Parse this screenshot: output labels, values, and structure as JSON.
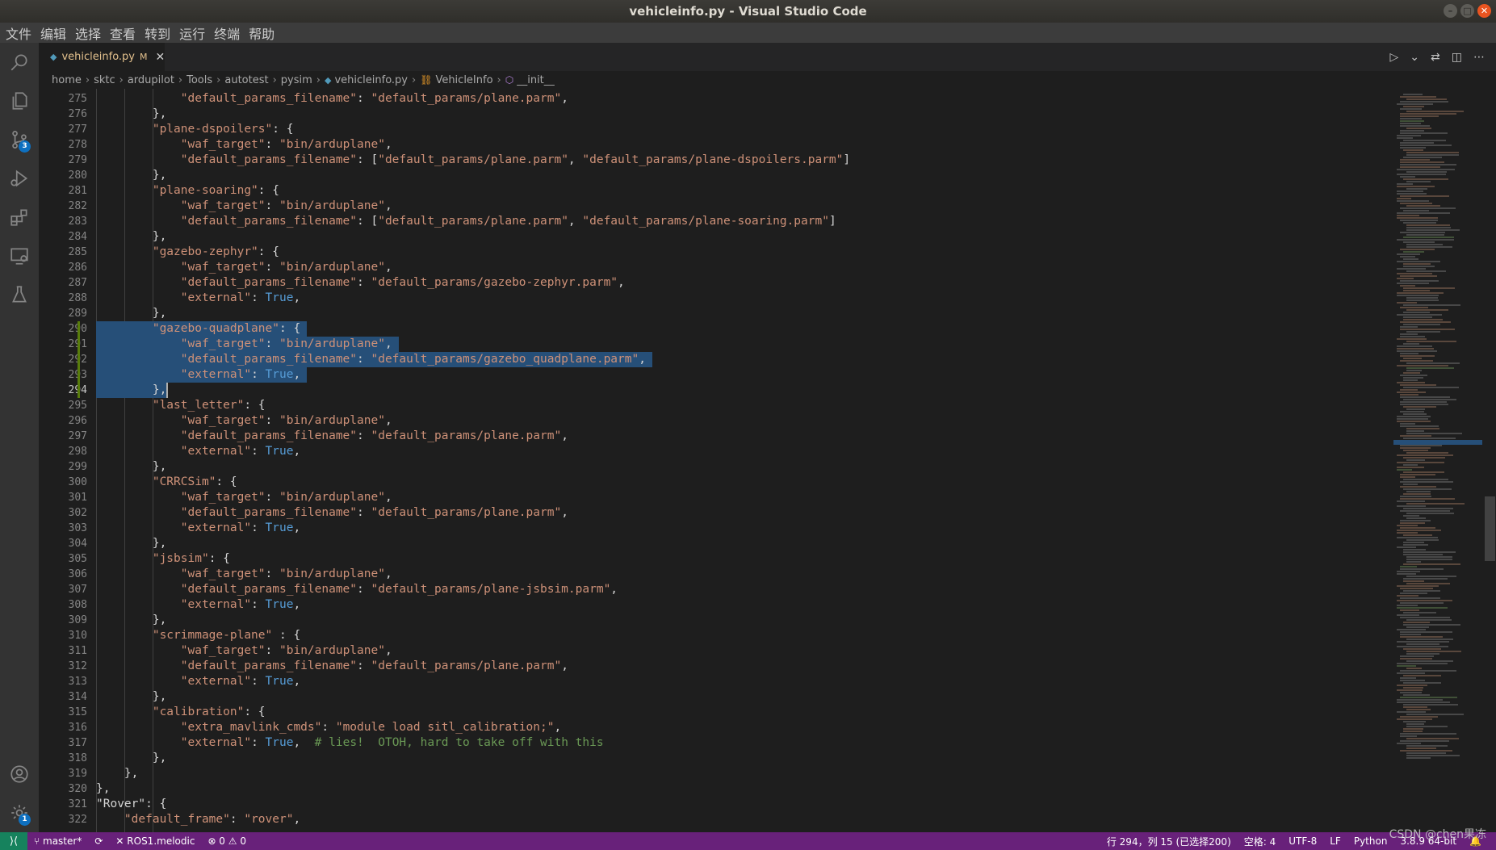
{
  "window": {
    "title": "vehicleinfo.py - Visual Studio Code"
  },
  "menu": [
    "文件",
    "编辑",
    "选择",
    "查看",
    "转到",
    "运行",
    "终端",
    "帮助"
  ],
  "activity": {
    "scm_badge": "3",
    "settings_badge": "1"
  },
  "tab": {
    "label": "vehicleinfo.py",
    "modified": "M"
  },
  "breadcrumbs": [
    "home",
    "sktc",
    "ardupilot",
    "Tools",
    "autotest",
    "pysim",
    "vehicleinfo.py",
    "VehicleInfo",
    "__init__"
  ],
  "editor": {
    "first_line": 275,
    "active_line": 294,
    "lines": [
      [
        [
          "",
          "            "
        ],
        [
          "s",
          "\"default_params_filename\""
        ],
        [
          "",
          ": "
        ],
        [
          "s",
          "\"default_params/plane.parm\""
        ],
        [
          "",
          ","
        ]
      ],
      [
        [
          "",
          "        },"
        ]
      ],
      [
        [
          "",
          "        "
        ],
        [
          "s",
          "\"plane-dspoilers\""
        ],
        [
          "",
          ": {"
        ]
      ],
      [
        [
          "",
          "            "
        ],
        [
          "s",
          "\"waf_target\""
        ],
        [
          "",
          ": "
        ],
        [
          "s",
          "\"bin/arduplane\""
        ],
        [
          "",
          ","
        ]
      ],
      [
        [
          "",
          "            "
        ],
        [
          "s",
          "\"default_params_filename\""
        ],
        [
          "",
          ": ["
        ],
        [
          "s",
          "\"default_params/plane.parm\""
        ],
        [
          "",
          ", "
        ],
        [
          "s",
          "\"default_params/plane-dspoilers.parm\""
        ],
        [
          "",
          "]"
        ]
      ],
      [
        [
          "",
          "        },"
        ]
      ],
      [
        [
          "",
          "        "
        ],
        [
          "s",
          "\"plane-soaring\""
        ],
        [
          "",
          ": {"
        ]
      ],
      [
        [
          "",
          "            "
        ],
        [
          "s",
          "\"waf_target\""
        ],
        [
          "",
          ": "
        ],
        [
          "s",
          "\"bin/arduplane\""
        ],
        [
          "",
          ","
        ]
      ],
      [
        [
          "",
          "            "
        ],
        [
          "s",
          "\"default_params_filename\""
        ],
        [
          "",
          ": ["
        ],
        [
          "s",
          "\"default_params/plane.parm\""
        ],
        [
          "",
          ", "
        ],
        [
          "s",
          "\"default_params/plane-soaring.parm\""
        ],
        [
          "",
          "]"
        ]
      ],
      [
        [
          "",
          "        },"
        ]
      ],
      [
        [
          "",
          "        "
        ],
        [
          "s",
          "\"gazebo-zephyr\""
        ],
        [
          "",
          ": {"
        ]
      ],
      [
        [
          "",
          "            "
        ],
        [
          "s",
          "\"waf_target\""
        ],
        [
          "",
          ": "
        ],
        [
          "s",
          "\"bin/arduplane\""
        ],
        [
          "",
          ","
        ]
      ],
      [
        [
          "",
          "            "
        ],
        [
          "s",
          "\"default_params_filename\""
        ],
        [
          "",
          ": "
        ],
        [
          "s",
          "\"default_params/gazebo-zephyr.parm\""
        ],
        [
          "",
          ","
        ]
      ],
      [
        [
          "",
          "            "
        ],
        [
          "s",
          "\"external\""
        ],
        [
          "",
          ": "
        ],
        [
          "k",
          "True"
        ],
        [
          "",
          ","
        ]
      ],
      [
        [
          "",
          "        },"
        ]
      ],
      [
        [
          "",
          "        "
        ],
        [
          "s",
          "\"gazebo-quadplane\""
        ],
        [
          "",
          ": {"
        ]
      ],
      [
        [
          "",
          "            "
        ],
        [
          "s",
          "\"waf_target\""
        ],
        [
          "",
          ": "
        ],
        [
          "s",
          "\"bin/arduplane\""
        ],
        [
          "",
          ","
        ]
      ],
      [
        [
          "",
          "            "
        ],
        [
          "s",
          "\"default_params_filename\""
        ],
        [
          "",
          ": "
        ],
        [
          "s",
          "\"default_params/gazebo_quadplane.parm\""
        ],
        [
          "",
          ","
        ]
      ],
      [
        [
          "",
          "            "
        ],
        [
          "s",
          "\"external\""
        ],
        [
          "",
          ": "
        ],
        [
          "k",
          "True"
        ],
        [
          "",
          ","
        ]
      ],
      [
        [
          "",
          "        },"
        ]
      ],
      [
        [
          "",
          "        "
        ],
        [
          "s",
          "\"last_letter\""
        ],
        [
          "",
          ": {"
        ]
      ],
      [
        [
          "",
          "            "
        ],
        [
          "s",
          "\"waf_target\""
        ],
        [
          "",
          ": "
        ],
        [
          "s",
          "\"bin/arduplane\""
        ],
        [
          "",
          ","
        ]
      ],
      [
        [
          "",
          "            "
        ],
        [
          "s",
          "\"default_params_filename\""
        ],
        [
          "",
          ": "
        ],
        [
          "s",
          "\"default_params/plane.parm\""
        ],
        [
          "",
          ","
        ]
      ],
      [
        [
          "",
          "            "
        ],
        [
          "s",
          "\"external\""
        ],
        [
          "",
          ": "
        ],
        [
          "k",
          "True"
        ],
        [
          "",
          ","
        ]
      ],
      [
        [
          "",
          "        },"
        ]
      ],
      [
        [
          "",
          "        "
        ],
        [
          "s",
          "\"CRRCSim\""
        ],
        [
          "",
          ": {"
        ]
      ],
      [
        [
          "",
          "            "
        ],
        [
          "s",
          "\"waf_target\""
        ],
        [
          "",
          ": "
        ],
        [
          "s",
          "\"bin/arduplane\""
        ],
        [
          "",
          ","
        ]
      ],
      [
        [
          "",
          "            "
        ],
        [
          "s",
          "\"default_params_filename\""
        ],
        [
          "",
          ": "
        ],
        [
          "s",
          "\"default_params/plane.parm\""
        ],
        [
          "",
          ","
        ]
      ],
      [
        [
          "",
          "            "
        ],
        [
          "s",
          "\"external\""
        ],
        [
          "",
          ": "
        ],
        [
          "k",
          "True"
        ],
        [
          "",
          ","
        ]
      ],
      [
        [
          "",
          "        },"
        ]
      ],
      [
        [
          "",
          "        "
        ],
        [
          "s",
          "\"jsbsim\""
        ],
        [
          "",
          ": {"
        ]
      ],
      [
        [
          "",
          "            "
        ],
        [
          "s",
          "\"waf_target\""
        ],
        [
          "",
          ": "
        ],
        [
          "s",
          "\"bin/arduplane\""
        ],
        [
          "",
          ","
        ]
      ],
      [
        [
          "",
          "            "
        ],
        [
          "s",
          "\"default_params_filename\""
        ],
        [
          "",
          ": "
        ],
        [
          "s",
          "\"default_params/plane-jsbsim.parm\""
        ],
        [
          "",
          ","
        ]
      ],
      [
        [
          "",
          "            "
        ],
        [
          "s",
          "\"external\""
        ],
        [
          "",
          ": "
        ],
        [
          "k",
          "True"
        ],
        [
          "",
          ","
        ]
      ],
      [
        [
          "",
          "        },"
        ]
      ],
      [
        [
          "",
          "        "
        ],
        [
          "s",
          "\"scrimmage-plane\""
        ],
        [
          "",
          " : {"
        ]
      ],
      [
        [
          "",
          "            "
        ],
        [
          "s",
          "\"waf_target\""
        ],
        [
          "",
          ": "
        ],
        [
          "s",
          "\"bin/arduplane\""
        ],
        [
          "",
          ","
        ]
      ],
      [
        [
          "",
          "            "
        ],
        [
          "s",
          "\"default_params_filename\""
        ],
        [
          "",
          ": "
        ],
        [
          "s",
          "\"default_params/plane.parm\""
        ],
        [
          "",
          ","
        ]
      ],
      [
        [
          "",
          "            "
        ],
        [
          "s",
          "\"external\""
        ],
        [
          "",
          ": "
        ],
        [
          "k",
          "True"
        ],
        [
          "",
          ","
        ]
      ],
      [
        [
          "",
          "        },"
        ]
      ],
      [
        [
          "",
          "        "
        ],
        [
          "s",
          "\"calibration\""
        ],
        [
          "",
          ": {"
        ]
      ],
      [
        [
          "",
          "            "
        ],
        [
          "s",
          "\"extra_mavlink_cmds\""
        ],
        [
          "",
          ": "
        ],
        [
          "s",
          "\"module load sitl_calibration;\""
        ],
        [
          "",
          ","
        ]
      ],
      [
        [
          "",
          "            "
        ],
        [
          "s",
          "\"external\""
        ],
        [
          "",
          ": "
        ],
        [
          "k",
          "True"
        ],
        [
          "",
          ",  "
        ],
        [
          "c",
          "# lies!  OTOH, hard to take off with this"
        ]
      ],
      [
        [
          "",
          "        },"
        ]
      ],
      [
        [
          "",
          "    },"
        ]
      ],
      [
        [
          "",
          "},"
        ]
      ],
      [
        [
          "",
          "\"Rover\": {"
        ]
      ],
      [
        [
          "",
          "    "
        ],
        [
          "s",
          "\"default_frame\""
        ],
        [
          "",
          ": "
        ],
        [
          "s",
          "\"rover\""
        ],
        [
          "",
          ","
        ]
      ]
    ]
  },
  "statusbar": {
    "branch": "master*",
    "ros": "ROS1.melodic",
    "problems": "⊗ 0 ⚠ 0",
    "cursor": "行 294，列 15 (已选择200)",
    "spaces": "空格: 4",
    "encoding": "UTF-8",
    "eol": "LF",
    "language": "Python",
    "interpreter": "3.8.9 64-bit"
  },
  "watermark": "CSDN @chen果冻"
}
